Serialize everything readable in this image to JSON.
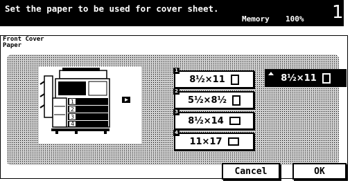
{
  "header": {
    "instruction": "Set the paper to be used for cover sheet.",
    "memory_label": "Memory",
    "memory_value": "100%",
    "screen_number": "1"
  },
  "panel": {
    "label_line1": "Front Cover",
    "label_line2": "Paper"
  },
  "machine": {
    "tray_numbers": [
      "1",
      "2",
      "3",
      "4"
    ]
  },
  "trays": [
    {
      "number": "1",
      "size": "8½×11",
      "orientation": "portrait"
    },
    {
      "number": "2",
      "size": "5½×8½",
      "orientation": "portrait"
    },
    {
      "number": "3",
      "size": "8½×14",
      "orientation": "landscape"
    },
    {
      "number": "4",
      "size": "11×17",
      "orientation": "landscape"
    }
  ],
  "selected_paper": {
    "size": "8½×11",
    "orientation": "portrait"
  },
  "buttons": {
    "cancel": "Cancel",
    "ok": "OK"
  }
}
